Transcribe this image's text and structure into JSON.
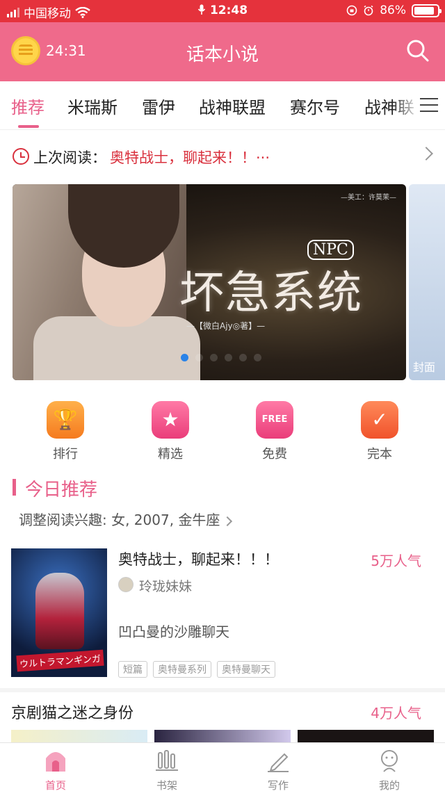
{
  "status_bar": {
    "carrier": "中国移动",
    "time": "12:48",
    "battery": "86%",
    "battery_level": 0.86
  },
  "header": {
    "timer": "24:31",
    "title": "话本小说",
    "icons": [
      "alarm-coin-icon",
      "search-icon"
    ]
  },
  "tabs": [
    {
      "label": "推荐",
      "active": true
    },
    {
      "label": "米瑞斯"
    },
    {
      "label": "雷伊"
    },
    {
      "label": "战神联盟"
    },
    {
      "label": "赛尔号"
    },
    {
      "label": "战神联"
    }
  ],
  "last_read": {
    "label": "上次阅读：",
    "book": "奥特战士，聊起来！！···"
  },
  "banner": {
    "credit": "—美工：许莫茉—",
    "badge": "NPC",
    "book_title": "坏急系统",
    "author": "—【微白Ajy◎著】—",
    "slide_count": 6,
    "active_slide": 1,
    "next_tag": "封面"
  },
  "quick_entries": [
    {
      "label": "排行",
      "icon": "trophy-icon",
      "color": "#f57b1f"
    },
    {
      "label": "精选",
      "icon": "star-icon",
      "color": "#ea3d7a"
    },
    {
      "label": "免费",
      "icon": "free-tag-icon",
      "badge": "FREE",
      "color": "#ea3d7a"
    },
    {
      "label": "完本",
      "icon": "check-icon",
      "color": "#f0522b"
    }
  ],
  "today": {
    "title": "今日推荐",
    "adjust": "调整阅读兴趣: 女, 2007, 金牛座"
  },
  "featured": {
    "title": "奥特战士，聊起来！！！",
    "popularity": "5万人气",
    "author": "玲珑妹妹",
    "description": "凹凸曼的沙雕聊天",
    "tags": [
      "短篇",
      "奥特曼系列",
      "奥特曼聊天"
    ],
    "cover_logo": "ウルトラマンギンガ"
  },
  "second": {
    "title": "京剧猫之迷之身份",
    "popularity": "4万人气"
  },
  "bottom_nav": [
    {
      "label": "首页",
      "icon": "home-icon",
      "active": true
    },
    {
      "label": "书架",
      "icon": "bookshelf-icon"
    },
    {
      "label": "写作",
      "icon": "pen-icon"
    },
    {
      "label": "我的",
      "icon": "profile-icon"
    }
  ],
  "colors": {
    "status": "#e5323c",
    "header": "#ef6a8b",
    "accent": "#e8608a",
    "link_red": "#d9303d"
  }
}
